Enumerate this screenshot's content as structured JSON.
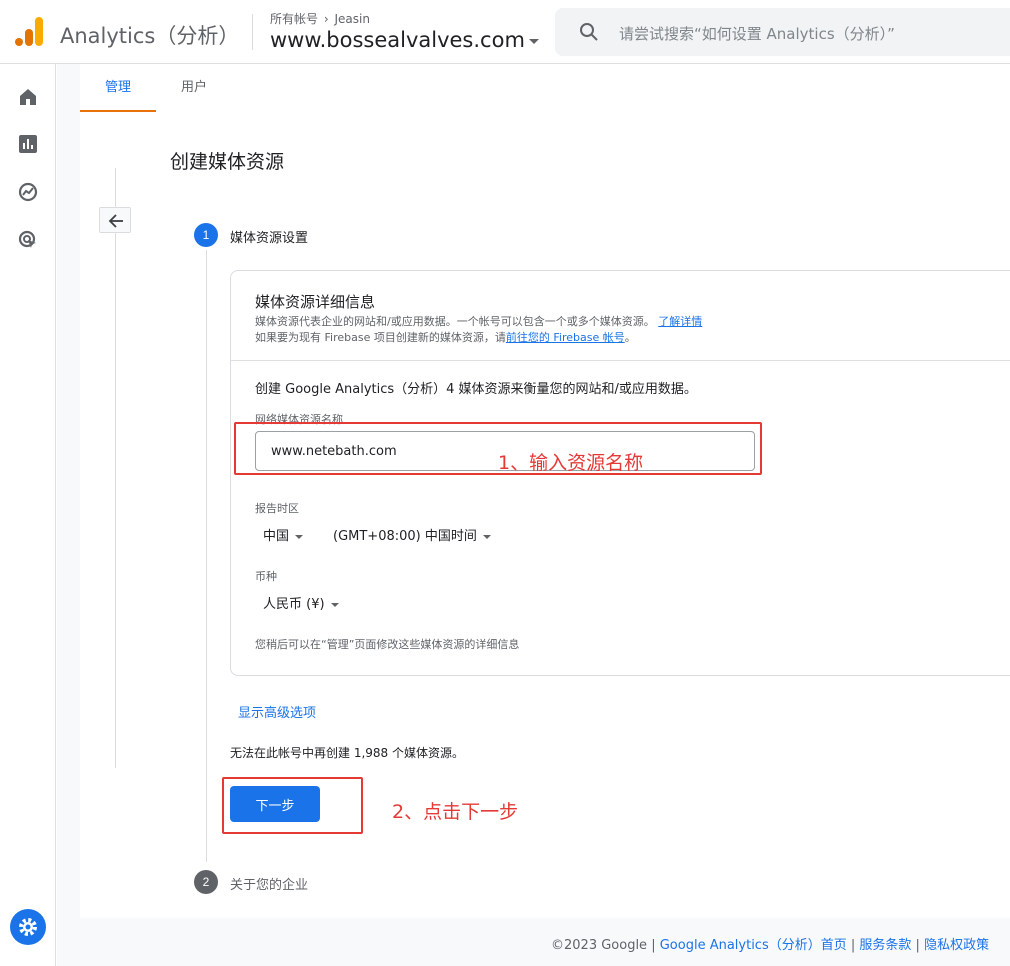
{
  "header": {
    "app_title": "Analytics（分析）",
    "breadcrumb_account_prefix": "所有帐号",
    "breadcrumb_account": "Jeasin",
    "property_name": "www.bossealvalves.com",
    "search_placeholder": "请尝试搜索“如何设置 Analytics（分析）”"
  },
  "sidebar": {
    "icons": [
      "home-icon",
      "reports-icon",
      "explore-icon",
      "advertising-icon"
    ],
    "settings_icon": "gear-icon"
  },
  "tabs": [
    {
      "label": "管理",
      "active": true
    },
    {
      "label": "用户",
      "active": false
    }
  ],
  "page": {
    "title": "创建媒体资源",
    "step1": {
      "number": "1",
      "label": "媒体资源设置"
    },
    "step2": {
      "number": "2",
      "label": "关于您的企业"
    }
  },
  "card": {
    "title": "媒体资源详细信息",
    "desc1": "媒体资源代表企业的网站和/或应用数据。一个帐号可以包含一个或多个媒体资源。",
    "desc1_link": "了解详情",
    "desc2": "如果要为现有 Firebase 项目创建新的媒体资源，请",
    "desc2_link": "前往您的 Firebase 帐号",
    "desc2_end": "。",
    "create_desc": "创建 Google Analytics（分析）4 媒体资源来衡量您的网站和/或应用数据。",
    "name_label": "网络媒体资源名称",
    "name_value": "www.netebath.com",
    "timezone_label": "报告时区",
    "country": "中国",
    "timezone": "(GMT+08:00) 中国时间",
    "currency_label": "币种",
    "currency": "人民币 (¥)",
    "later_note": "您稍后可以在“管理”页面修改这些媒体资源的详细信息"
  },
  "advanced_link": "显示高级选项",
  "limit_note": "无法在此帐号中再创建 1,988 个媒体资源。",
  "next_button": "下一步",
  "annotations": {
    "note1": "1、输入资源名称",
    "note2": "2、点击下一步"
  },
  "footer": {
    "copyright": "©2023 Google",
    "sep": " | ",
    "link1": "Google Analytics（分析）首页",
    "link2": "服务条款",
    "link3": "隐私权政策"
  },
  "colors": {
    "accent": "#1a73e8",
    "active_tab_underline": "#e8710a",
    "annotation": "#e53935",
    "logo_orange": "#f9ab00",
    "logo_dark_orange": "#e37400"
  }
}
